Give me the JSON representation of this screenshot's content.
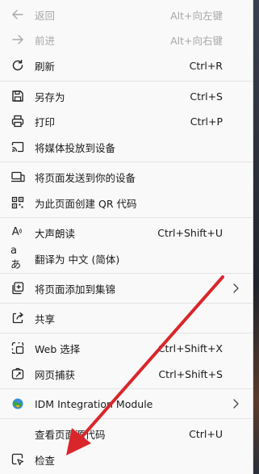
{
  "menu": {
    "back": {
      "label": "返回",
      "shortcut": "Alt+向左键"
    },
    "forward": {
      "label": "前进",
      "shortcut": "Alt+向右键"
    },
    "refresh": {
      "label": "刷新",
      "shortcut": "Ctrl+R"
    },
    "save_as": {
      "label": "另存为",
      "shortcut": "Ctrl+S"
    },
    "print": {
      "label": "打印",
      "shortcut": "Ctrl+P"
    },
    "cast": {
      "label": "将媒体投放到设备"
    },
    "send_page": {
      "label": "将页面发送到你的设备"
    },
    "qr_code": {
      "label": "为此页面创建 QR 代码"
    },
    "read_aloud": {
      "label": "大声朗读",
      "shortcut": "Ctrl+Shift+U",
      "icon_text": "A"
    },
    "translate": {
      "label": "翻译为 中文 (简体)",
      "icon_text": "aあ"
    },
    "add_collection": {
      "label": "将页面添加到集锦"
    },
    "share": {
      "label": "共享"
    },
    "web_select": {
      "label": "Web 选择",
      "shortcut": "Ctrl+Shift+X"
    },
    "web_capture": {
      "label": "网页捕获",
      "shortcut": "Ctrl+Shift+S"
    },
    "idm": {
      "label": "IDM Integration Module"
    },
    "view_source": {
      "label": "查看页面源代码",
      "shortcut": "Ctrl+U"
    },
    "inspect": {
      "label": "检查"
    }
  },
  "colors": {
    "arrow": "#d9262b",
    "menu_bg": "#f9f9f9",
    "disabled": "#a7a7a7"
  }
}
